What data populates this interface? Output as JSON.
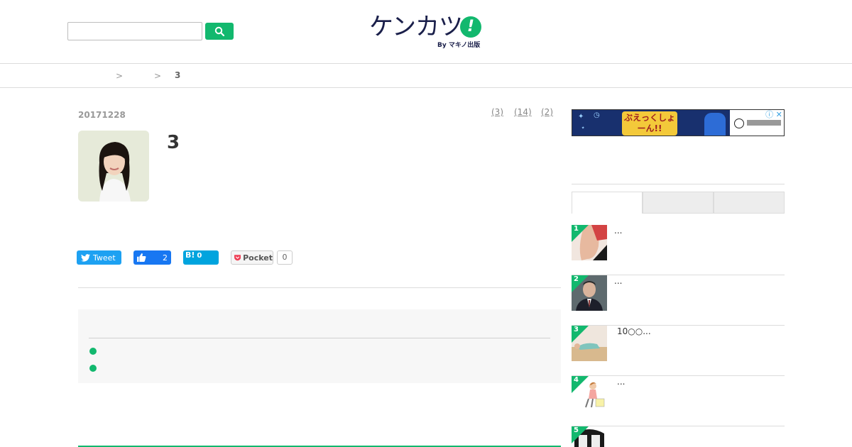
{
  "header": {
    "search_placeholder": "",
    "logo_text": "ケンカツ",
    "logo_mark": "!",
    "logo_sub": "By マキノ出版"
  },
  "breadcrumb": {
    "separator_1": ">",
    "separator_2": ">",
    "current": "3"
  },
  "article": {
    "date": "20171228",
    "tags": [
      "(3)",
      "(14)",
      "(2)"
    ],
    "title": "3"
  },
  "share": {
    "tweet_label": "Tweet",
    "like_count": "2",
    "hatena_label": "B!",
    "hatena_count": "0",
    "pocket_label": "Pocket",
    "pocket_count": "0"
  },
  "ad": {
    "headline": "ぶえっくしょーん!!",
    "close": "ⓘ ✕"
  },
  "sidebar": {
    "tabs": [
      "",
      "",
      ""
    ],
    "ranking": [
      {
        "rank": "1",
        "title": "..."
      },
      {
        "rank": "2",
        "title": "..."
      },
      {
        "rank": "3",
        "title": "10○○..."
      },
      {
        "rank": "4",
        "title": "..."
      },
      {
        "rank": "5",
        "title": ""
      }
    ]
  },
  "colors": {
    "accent": "#12b86e",
    "logo_navy": "#1a1f4a",
    "twitter": "#1da1f2",
    "facebook": "#1877f2",
    "hatena": "#00a4de"
  }
}
